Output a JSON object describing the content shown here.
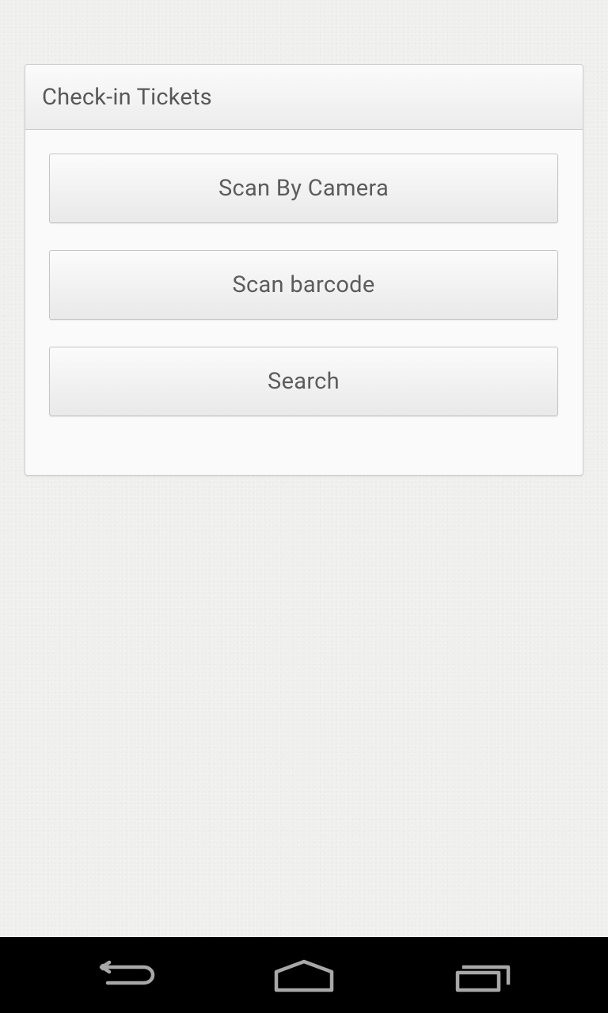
{
  "panel": {
    "title": "Check-in Tickets",
    "buttons": [
      {
        "label": "Scan By Camera"
      },
      {
        "label": "Scan barcode"
      },
      {
        "label": "Search"
      }
    ]
  },
  "navbar": {
    "icons": [
      "back-icon",
      "home-icon",
      "recents-icon"
    ]
  },
  "colors": {
    "background": "#efefee",
    "panel_header": "#f0f0f0",
    "text": "#5c5c5c",
    "navbar": "#000000",
    "nav_icon": "#a8a8a8"
  }
}
